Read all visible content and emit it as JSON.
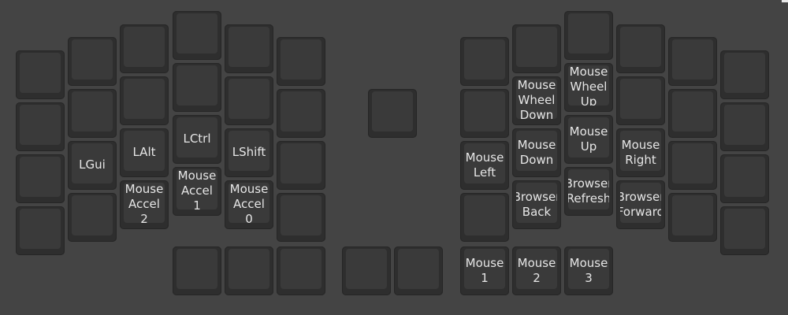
{
  "colors": {
    "background": "#444444",
    "key_base": "#2e2e2e",
    "key_top": "#3a3a3a",
    "legend": "#e6e6e6"
  },
  "left_half": {
    "col0": [
      "",
      "",
      "",
      ""
    ],
    "col1": [
      "",
      "",
      "LGui",
      ""
    ],
    "col2": [
      "",
      "",
      "LAlt",
      "Mouse\nAccel\n2"
    ],
    "col3": [
      "",
      "",
      "LCtrl",
      "Mouse\nAccel\n1"
    ],
    "col4": [
      "",
      "",
      "LShift",
      "Mouse\nAccel\n0"
    ],
    "col5": [
      "",
      "",
      "",
      ""
    ],
    "thumb": [
      "",
      "",
      ""
    ]
  },
  "center": {
    "middle": "",
    "thumb": [
      "",
      ""
    ]
  },
  "right_half": {
    "col0": [
      "",
      "",
      "Mouse\nLeft",
      ""
    ],
    "col1": [
      "",
      "Mouse\nWheel\nDown",
      "Mouse\nDown",
      "Browser\nBack"
    ],
    "col2": [
      "",
      "Mouse\nWheel\nUp",
      "Mouse\nUp",
      "Browser\nRefresh"
    ],
    "col3": [
      "",
      "",
      "Mouse\nRight",
      "Browser\nForward"
    ],
    "col4": [
      "",
      "",
      "",
      ""
    ],
    "col5": [
      "",
      "",
      "",
      ""
    ],
    "thumb": [
      "Mouse\n1",
      "Mouse\n2",
      "Mouse\n3"
    ]
  }
}
